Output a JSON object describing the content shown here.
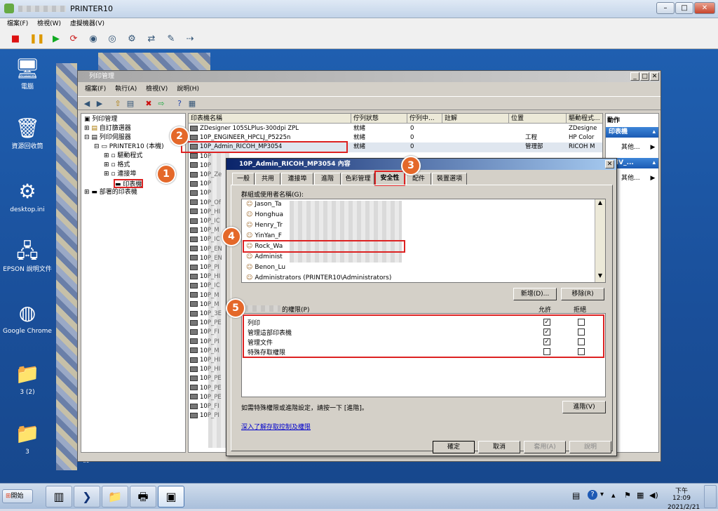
{
  "vm": {
    "title": "PRINTER10",
    "menu": [
      "檔案(F)",
      "檢視(W)",
      "虛擬機器(V)"
    ]
  },
  "desktop": {
    "icons": [
      {
        "label": "電腦"
      },
      {
        "label": "資源回收筒"
      },
      {
        "label": "desktop.ini"
      },
      {
        "label": "EPSON 說明文件"
      },
      {
        "label": "Google Chrome"
      },
      {
        "label": "3 (2)"
      },
      {
        "label": "3"
      }
    ],
    "bottom_text": "d使..."
  },
  "pm": {
    "title": "列印管理",
    "menu": [
      "檔案(F)",
      "執行(A)",
      "檢視(V)",
      "說明(H)"
    ],
    "tree": [
      "列印管理",
      "自訂篩選器",
      "列印伺服器",
      "PRINTER10 (本機)",
      "驅動程式",
      "格式",
      "連接埠",
      "印表機",
      "部署的印表機"
    ],
    "columns": [
      "印表機名稱",
      "佇列狀態",
      "佇列中...",
      "註解",
      "位置",
      "驅動程式..."
    ],
    "rows": [
      {
        "name": "ZDesigner 105SLPlus-300dpi ZPL",
        "status": "就緒",
        "queue": "0",
        "loc": "",
        "drv": "ZDesigne"
      },
      {
        "name": "10P_ENGINEER_HPCLJ_P5225n",
        "status": "就緒",
        "queue": "0",
        "loc": "工程",
        "drv": "HP Color"
      },
      {
        "name": "10P_Admin_RICOH_MP3054",
        "status": "就緒",
        "queue": "0",
        "loc": "管理部",
        "drv": "RICOH M"
      },
      {
        "name": "10P",
        "status": "",
        "queue": "",
        "loc": "",
        "drv": ""
      },
      {
        "name": "10P",
        "status": "",
        "queue": "",
        "loc": "",
        "drv": ""
      },
      {
        "name": "10P_Ze",
        "status": "",
        "queue": "",
        "loc": "",
        "drv": ""
      },
      {
        "name": "10P",
        "status": "",
        "queue": "",
        "loc": "",
        "drv": ""
      },
      {
        "name": "10P",
        "status": "",
        "queue": "",
        "loc": "",
        "drv": ""
      },
      {
        "name": "10P_Of",
        "status": "",
        "queue": "",
        "loc": "",
        "drv": ""
      },
      {
        "name": "10P_HI",
        "status": "",
        "queue": "",
        "loc": "",
        "drv": ""
      },
      {
        "name": "10P_IC",
        "status": "",
        "queue": "",
        "loc": "",
        "drv": ""
      },
      {
        "name": "10P_M",
        "status": "",
        "queue": "",
        "loc": "",
        "drv": ""
      },
      {
        "name": "10P_IC",
        "status": "",
        "queue": "",
        "loc": "",
        "drv": ""
      },
      {
        "name": "10P_EN",
        "status": "",
        "queue": "",
        "loc": "",
        "drv": ""
      },
      {
        "name": "10P_EN",
        "status": "",
        "queue": "",
        "loc": "",
        "drv": ""
      },
      {
        "name": "10P_PI",
        "status": "",
        "queue": "",
        "loc": "",
        "drv": ""
      },
      {
        "name": "10P_HI",
        "status": "",
        "queue": "",
        "loc": "",
        "drv": ""
      },
      {
        "name": "10P_IC",
        "status": "",
        "queue": "",
        "loc": "",
        "drv": ""
      },
      {
        "name": "10P_M",
        "status": "",
        "queue": "",
        "loc": "",
        "drv": ""
      },
      {
        "name": "10P_M",
        "status": "",
        "queue": "",
        "loc": "",
        "drv": ""
      },
      {
        "name": "10P_3E",
        "status": "",
        "queue": "",
        "loc": "",
        "drv": ""
      },
      {
        "name": "10P_PE",
        "status": "",
        "queue": "",
        "loc": "",
        "drv": ""
      },
      {
        "name": "10P_FI",
        "status": "",
        "queue": "",
        "loc": "",
        "drv": ""
      },
      {
        "name": "10P_PI",
        "status": "",
        "queue": "",
        "loc": "",
        "drv": ""
      },
      {
        "name": "10P_M",
        "status": "",
        "queue": "",
        "loc": "",
        "drv": ""
      },
      {
        "name": "10P_HI",
        "status": "",
        "queue": "",
        "loc": "",
        "drv": ""
      },
      {
        "name": "10P_HI",
        "status": "",
        "queue": "",
        "loc": "",
        "drv": ""
      },
      {
        "name": "10P_PE",
        "status": "",
        "queue": "",
        "loc": "",
        "drv": ""
      },
      {
        "name": "10P_PE",
        "status": "",
        "queue": "",
        "loc": "",
        "drv": ""
      },
      {
        "name": "10P_PE",
        "status": "",
        "queue": "",
        "loc": "",
        "drv": ""
      },
      {
        "name": "10P_FI",
        "status": "",
        "queue": "",
        "loc": "",
        "drv": ""
      },
      {
        "name": "10P_PI",
        "status": "",
        "queue": "",
        "loc": "",
        "drv": ""
      }
    ],
    "actions": {
      "header": "動作",
      "sec1": "印表機",
      "other1": "其他...",
      "sec2": "PHV_...",
      "other2": "其他..."
    }
  },
  "dlg": {
    "title": "10P_Admin_RICOH_MP3054 內容",
    "tabs": [
      "一般",
      "共用",
      "連接埠",
      "進階",
      "色彩管理",
      "安全性",
      "配件",
      "裝置選項"
    ],
    "group_label": "群組或使用者名稱(G):",
    "users": [
      "Jason_Ta",
      "Honghua",
      "Henry_Tr",
      "YinYan_F",
      "Rock_Wa",
      "Administ",
      "Benon_Lu",
      "Administrators (PRINTER10\\Administrators)"
    ],
    "add": "新增(D)...",
    "remove": "移除(R)",
    "perm_label": "的權限(P)",
    "allow": "允許",
    "deny": "拒絕",
    "perms": [
      {
        "name": "列印",
        "allow": "✓",
        "deny": ""
      },
      {
        "name": "管理這部印表機",
        "allow": "✓",
        "deny": ""
      },
      {
        "name": "管理文件",
        "allow": "✓",
        "deny": ""
      },
      {
        "name": "特殊存取權限",
        "allow": "",
        "deny": ""
      }
    ],
    "advanced_hint": "如需特殊權限或進階設定，請按一下 [進階]。",
    "advanced": "進階(V)",
    "link": "深入了解存取控制及權限",
    "ok": "確定",
    "cancel": "取消",
    "apply": "套用(A)",
    "help": "說明"
  },
  "badges": [
    "1",
    "2",
    "3",
    "4",
    "5"
  ],
  "clock": {
    "time": "下午 12:09",
    "date": "2021/2/21"
  },
  "start": "開始"
}
